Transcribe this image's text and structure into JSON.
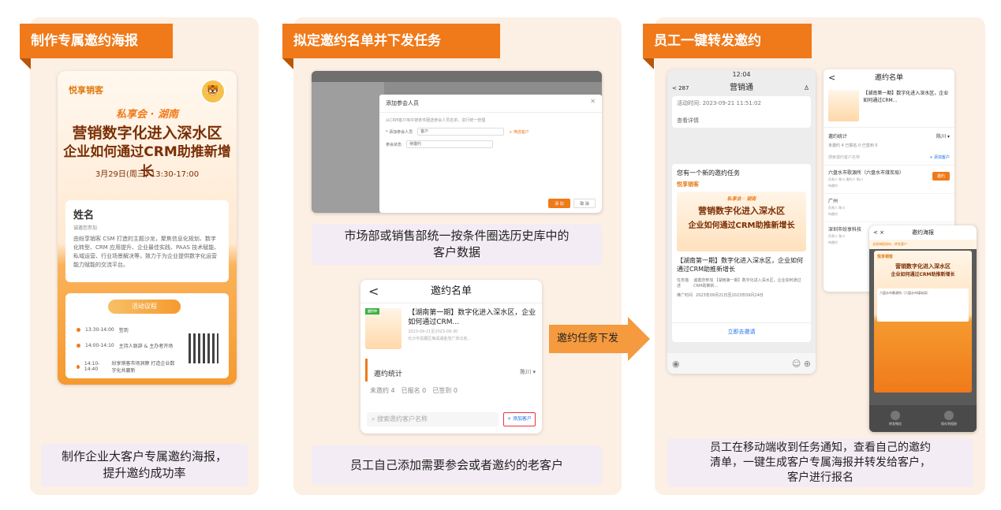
{
  "panels": [
    {
      "title": "制作专属邀约海报",
      "caption": "制作企业大客户专属邀约海报，\n提升邀约成功率"
    },
    {
      "title": "拟定邀约名单并下发任务",
      "caption_top": "市场部或销售部统一按条件圈选历史库中的\n客户数据",
      "caption_bottom": "员工自己添加需要参会或者邀约的老客户"
    },
    {
      "title": "员工一键转发邀约",
      "caption": "员工在移动端收到任务通知，查看自己的邀约\n清单，一键生成客户专属海报并转发给客户，\n客户进行报名"
    }
  ],
  "poster": {
    "logo": "悦享销客",
    "subtitle": "私享会 · 湖南",
    "title_line1": "营销数字化进入深水区",
    "title_line2": "企业如何通过CRM助推新增长",
    "date": "3月29日(周三) 13:30-17:00",
    "name_label": "姓名",
    "name_sub": "诚邀您参加",
    "description": "由纷享销客 CSM 打造的主题沙龙，聚焦信息化规划、数字化转型、CRM 应用提升、企业最佳实践、PAAS 技术赋能、私域运营、行业场景解决等，致力于为企业提供数字化运营能力赋能的交流平台。",
    "agenda_title": "活动议程",
    "agenda": [
      {
        "time": "13:30-14:00",
        "item": "签到"
      },
      {
        "time": "14:00-14:10",
        "item": "主持人致辞 & 主办者开场"
      },
      {
        "time": "14:10-14:40",
        "item": "纷享销客市场洞察 打造企业数字化共赢新"
      }
    ]
  },
  "admin_dialog": {
    "title": "添加参会人员",
    "hint": "从CRM客户库中按条件圈选参会人员名单，进行统一管理",
    "field1_label": "* 添加参会人员",
    "field1_value": "客户",
    "field1_link": "+ 筛选客户",
    "field2_label": "参会状态",
    "field2_value": "待邀约",
    "btn_add": "添 加",
    "btn_cancel": "取 消"
  },
  "invite_list": {
    "back": "<",
    "title": "邀约名单",
    "status": "进行中",
    "event_title": "【湖南第一期】数字化进入深水区，企业如何通过CRM...",
    "event_date": "2023-09-21至2023-09-30",
    "event_place": "长沙市岳麓区梅溪湖金茂广场北塔...",
    "stat_title": "邀约统计",
    "city": "陈川 ▾",
    "stats": [
      "未邀约 4",
      "已报名 0",
      "已签到 0"
    ],
    "search_placeholder": "搜索邀约客户名称",
    "add_customer": "+ 添加客户"
  },
  "arrow_label": "邀约任务下发",
  "chat": {
    "status_time": "12:04",
    "title": "营销通",
    "back": "< 287",
    "time_line": "活动时间: 2023-09-21 11:51:02",
    "detail": "查看详情",
    "card_title": "您有一个新的邀约任务",
    "logo": "悦享销客",
    "sub": "私享会 · 湖南",
    "poster_t1": "营销数字化进入深水区",
    "poster_t2": "企业如何通过CRM助推新增长",
    "name": "【湖南第一期】数字化进入深水区，企业如何通过CRM助推新增长",
    "task_desc_label": "任务描述",
    "task_desc": "诚邀您参加 【湖南第一期】数字化进入深水区，企业如何通过CRM助推新...",
    "push_time_label": "推广时间",
    "push_time": "2023年09月21日至2023年09月24日",
    "link": "立即去邀请",
    "input_left": "◉",
    "input_right": "☺ ⊕"
  },
  "list_phone": {
    "back": "<",
    "title": "邀约名单",
    "event_title": "【湖南第一期】数字化进入深水区，企业如何通过CRM...",
    "stat_title": "邀约统计",
    "city": "陈川 ▾",
    "stats": "未邀约 4    已报名 0    已签到 0",
    "search": "搜索邀约客户名称",
    "add": "+ 添加客户",
    "items": [
      {
        "name": "六盘水市歌源所（六盘水市煤炭局）",
        "meta": "负责人 陈川  邀约人 陈川",
        "state": "待邀约"
      },
      {
        "name": "广州",
        "meta": "负责人 陈川",
        "state": "待邀约"
      },
      {
        "name": "深圳市纷享科技",
        "meta": "负责人 陈川",
        "state": "待邀约"
      }
    ],
    "invite_btn": "邀约"
  },
  "poster_phone": {
    "icons": "< ×",
    "title": "邀约海报",
    "tip": "长按海报保存，转发客户",
    "logo": "悦享销客",
    "t1": "营销数字化进入深水区",
    "t2": "企业如何通过CRM助推新增长",
    "card": "六盘水市歌源所（六盘水市煤炭局）",
    "btn1": "转发微信",
    "btn2": "保存到相册"
  }
}
